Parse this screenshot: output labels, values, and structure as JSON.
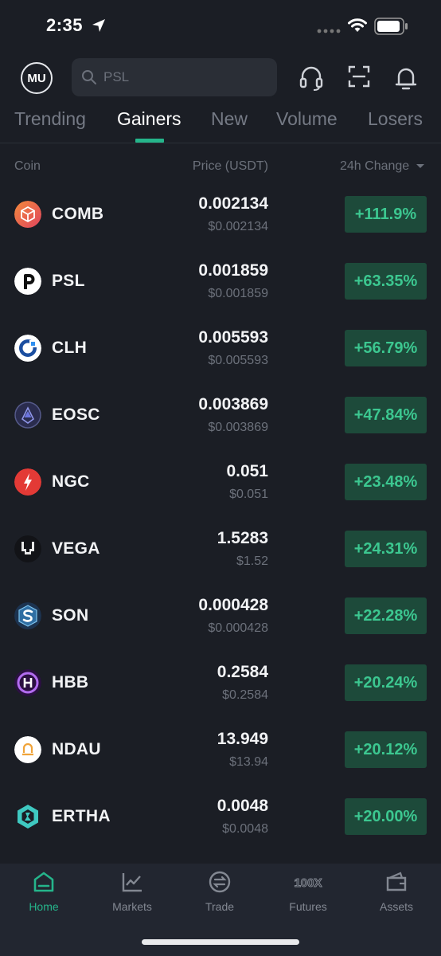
{
  "status_bar": {
    "time": "2:35"
  },
  "header": {
    "avatar_initials": "MU",
    "search_value": "PSL"
  },
  "tabs": [
    {
      "label": "Trending"
    },
    {
      "label": "Gainers"
    },
    {
      "label": "New"
    },
    {
      "label": "Volume"
    },
    {
      "label": "Losers"
    }
  ],
  "active_tab": "Gainers",
  "columns": {
    "coin": "Coin",
    "price": "Price (USDT)",
    "change": "24h Change"
  },
  "rows": [
    {
      "coin": "COMB",
      "price": "0.002134",
      "price_usd": "$0.002134",
      "change": "+111.9%",
      "icon": "comb-icon"
    },
    {
      "coin": "PSL",
      "price": "0.001859",
      "price_usd": "$0.001859",
      "change": "+63.35%",
      "icon": "psl-icon"
    },
    {
      "coin": "CLH",
      "price": "0.005593",
      "price_usd": "$0.005593",
      "change": "+56.79%",
      "icon": "clh-icon"
    },
    {
      "coin": "EOSC",
      "price": "0.003869",
      "price_usd": "$0.003869",
      "change": "+47.84%",
      "icon": "eosc-icon"
    },
    {
      "coin": "NGC",
      "price": "0.051",
      "price_usd": "$0.051",
      "change": "+23.48%",
      "icon": "ngc-icon"
    },
    {
      "coin": "VEGA",
      "price": "1.5283",
      "price_usd": "$1.52",
      "change": "+24.31%",
      "icon": "vega-icon"
    },
    {
      "coin": "SON",
      "price": "0.000428",
      "price_usd": "$0.000428",
      "change": "+22.28%",
      "icon": "son-icon"
    },
    {
      "coin": "HBB",
      "price": "0.2584",
      "price_usd": "$0.2584",
      "change": "+20.24%",
      "icon": "hbb-icon"
    },
    {
      "coin": "NDAU",
      "price": "13.949",
      "price_usd": "$13.94",
      "change": "+20.12%",
      "icon": "ndau-icon"
    },
    {
      "coin": "ERTHA",
      "price": "0.0048",
      "price_usd": "$0.0048",
      "change": "+20.00%",
      "icon": "ertha-icon"
    }
  ],
  "bottom_nav": [
    {
      "label": "Home",
      "icon": "home-icon"
    },
    {
      "label": "Markets",
      "icon": "markets-icon"
    },
    {
      "label": "Trade",
      "icon": "trade-icon"
    },
    {
      "label": "Futures",
      "icon": "futures-icon"
    },
    {
      "label": "Assets",
      "icon": "assets-icon"
    }
  ],
  "active_nav": "Home",
  "colors": {
    "accent": "#25b58b",
    "gain_text": "#3cc790",
    "gain_bg": "#1d4a3a",
    "background": "#1b1e25"
  }
}
